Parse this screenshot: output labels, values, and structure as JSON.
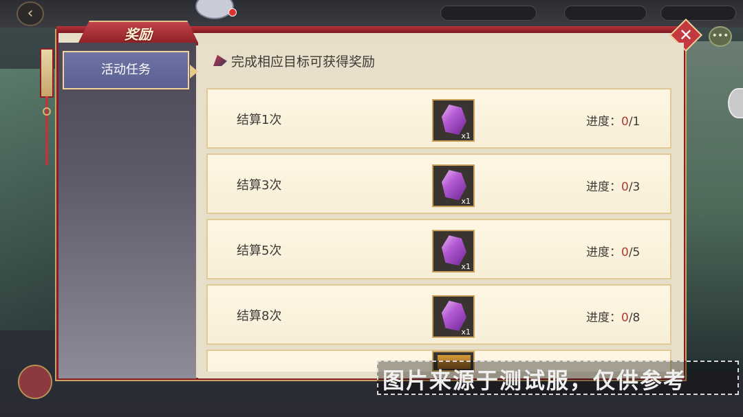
{
  "panel": {
    "title": "奖励",
    "close_icon": "close-icon",
    "chat_icon": "chat-icon"
  },
  "nav": {
    "items": [
      {
        "label": "活动任务",
        "selected": true
      }
    ]
  },
  "content": {
    "header": "完成相应目标可获得奖励",
    "progress_label": "进度：",
    "rows": [
      {
        "label": "结算1次",
        "reward_icon": "purple-crystal-icon",
        "qty": "x1",
        "current": "0",
        "total": "/1"
      },
      {
        "label": "结算3次",
        "reward_icon": "purple-crystal-icon",
        "qty": "x1",
        "current": "0",
        "total": "/3"
      },
      {
        "label": "结算5次",
        "reward_icon": "purple-crystal-icon",
        "qty": "x1",
        "current": "0",
        "total": "/5"
      },
      {
        "label": "结算8次",
        "reward_icon": "purple-crystal-icon",
        "qty": "x1",
        "current": "0",
        "total": "/8"
      }
    ]
  },
  "watermark": "图片来源于测试服，仅供参考",
  "colors": {
    "accent_red": "#8b1e24",
    "progress_current": "#b23a34",
    "nav_selected": "#5a6092"
  }
}
